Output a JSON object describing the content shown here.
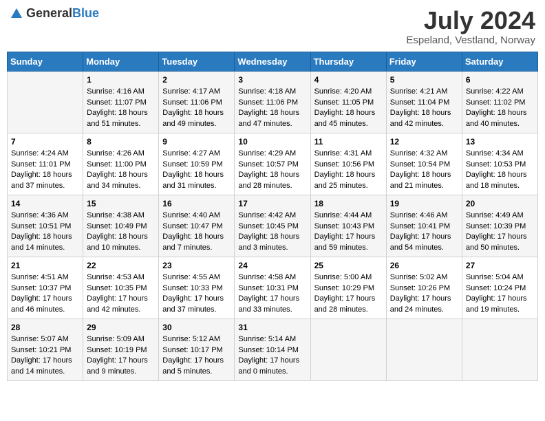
{
  "logo": {
    "text_general": "General",
    "text_blue": "Blue"
  },
  "title": {
    "main": "July 2024",
    "sub": "Espeland, Vestland, Norway"
  },
  "weekdays": [
    "Sunday",
    "Monday",
    "Tuesday",
    "Wednesday",
    "Thursday",
    "Friday",
    "Saturday"
  ],
  "weeks": [
    [
      {
        "day": "",
        "lines": []
      },
      {
        "day": "1",
        "lines": [
          "Sunrise: 4:16 AM",
          "Sunset: 11:07 PM",
          "Daylight: 18 hours",
          "and 51 minutes."
        ]
      },
      {
        "day": "2",
        "lines": [
          "Sunrise: 4:17 AM",
          "Sunset: 11:06 PM",
          "Daylight: 18 hours",
          "and 49 minutes."
        ]
      },
      {
        "day": "3",
        "lines": [
          "Sunrise: 4:18 AM",
          "Sunset: 11:06 PM",
          "Daylight: 18 hours",
          "and 47 minutes."
        ]
      },
      {
        "day": "4",
        "lines": [
          "Sunrise: 4:20 AM",
          "Sunset: 11:05 PM",
          "Daylight: 18 hours",
          "and 45 minutes."
        ]
      },
      {
        "day": "5",
        "lines": [
          "Sunrise: 4:21 AM",
          "Sunset: 11:04 PM",
          "Daylight: 18 hours",
          "and 42 minutes."
        ]
      },
      {
        "day": "6",
        "lines": [
          "Sunrise: 4:22 AM",
          "Sunset: 11:02 PM",
          "Daylight: 18 hours",
          "and 40 minutes."
        ]
      }
    ],
    [
      {
        "day": "7",
        "lines": [
          "Sunrise: 4:24 AM",
          "Sunset: 11:01 PM",
          "Daylight: 18 hours",
          "and 37 minutes."
        ]
      },
      {
        "day": "8",
        "lines": [
          "Sunrise: 4:26 AM",
          "Sunset: 11:00 PM",
          "Daylight: 18 hours",
          "and 34 minutes."
        ]
      },
      {
        "day": "9",
        "lines": [
          "Sunrise: 4:27 AM",
          "Sunset: 10:59 PM",
          "Daylight: 18 hours",
          "and 31 minutes."
        ]
      },
      {
        "day": "10",
        "lines": [
          "Sunrise: 4:29 AM",
          "Sunset: 10:57 PM",
          "Daylight: 18 hours",
          "and 28 minutes."
        ]
      },
      {
        "day": "11",
        "lines": [
          "Sunrise: 4:31 AM",
          "Sunset: 10:56 PM",
          "Daylight: 18 hours",
          "and 25 minutes."
        ]
      },
      {
        "day": "12",
        "lines": [
          "Sunrise: 4:32 AM",
          "Sunset: 10:54 PM",
          "Daylight: 18 hours",
          "and 21 minutes."
        ]
      },
      {
        "day": "13",
        "lines": [
          "Sunrise: 4:34 AM",
          "Sunset: 10:53 PM",
          "Daylight: 18 hours",
          "and 18 minutes."
        ]
      }
    ],
    [
      {
        "day": "14",
        "lines": [
          "Sunrise: 4:36 AM",
          "Sunset: 10:51 PM",
          "Daylight: 18 hours",
          "and 14 minutes."
        ]
      },
      {
        "day": "15",
        "lines": [
          "Sunrise: 4:38 AM",
          "Sunset: 10:49 PM",
          "Daylight: 18 hours",
          "and 10 minutes."
        ]
      },
      {
        "day": "16",
        "lines": [
          "Sunrise: 4:40 AM",
          "Sunset: 10:47 PM",
          "Daylight: 18 hours",
          "and 7 minutes."
        ]
      },
      {
        "day": "17",
        "lines": [
          "Sunrise: 4:42 AM",
          "Sunset: 10:45 PM",
          "Daylight: 18 hours",
          "and 3 minutes."
        ]
      },
      {
        "day": "18",
        "lines": [
          "Sunrise: 4:44 AM",
          "Sunset: 10:43 PM",
          "Daylight: 17 hours",
          "and 59 minutes."
        ]
      },
      {
        "day": "19",
        "lines": [
          "Sunrise: 4:46 AM",
          "Sunset: 10:41 PM",
          "Daylight: 17 hours",
          "and 54 minutes."
        ]
      },
      {
        "day": "20",
        "lines": [
          "Sunrise: 4:49 AM",
          "Sunset: 10:39 PM",
          "Daylight: 17 hours",
          "and 50 minutes."
        ]
      }
    ],
    [
      {
        "day": "21",
        "lines": [
          "Sunrise: 4:51 AM",
          "Sunset: 10:37 PM",
          "Daylight: 17 hours",
          "and 46 minutes."
        ]
      },
      {
        "day": "22",
        "lines": [
          "Sunrise: 4:53 AM",
          "Sunset: 10:35 PM",
          "Daylight: 17 hours",
          "and 42 minutes."
        ]
      },
      {
        "day": "23",
        "lines": [
          "Sunrise: 4:55 AM",
          "Sunset: 10:33 PM",
          "Daylight: 17 hours",
          "and 37 minutes."
        ]
      },
      {
        "day": "24",
        "lines": [
          "Sunrise: 4:58 AM",
          "Sunset: 10:31 PM",
          "Daylight: 17 hours",
          "and 33 minutes."
        ]
      },
      {
        "day": "25",
        "lines": [
          "Sunrise: 5:00 AM",
          "Sunset: 10:29 PM",
          "Daylight: 17 hours",
          "and 28 minutes."
        ]
      },
      {
        "day": "26",
        "lines": [
          "Sunrise: 5:02 AM",
          "Sunset: 10:26 PM",
          "Daylight: 17 hours",
          "and 24 minutes."
        ]
      },
      {
        "day": "27",
        "lines": [
          "Sunrise: 5:04 AM",
          "Sunset: 10:24 PM",
          "Daylight: 17 hours",
          "and 19 minutes."
        ]
      }
    ],
    [
      {
        "day": "28",
        "lines": [
          "Sunrise: 5:07 AM",
          "Sunset: 10:21 PM",
          "Daylight: 17 hours",
          "and 14 minutes."
        ]
      },
      {
        "day": "29",
        "lines": [
          "Sunrise: 5:09 AM",
          "Sunset: 10:19 PM",
          "Daylight: 17 hours",
          "and 9 minutes."
        ]
      },
      {
        "day": "30",
        "lines": [
          "Sunrise: 5:12 AM",
          "Sunset: 10:17 PM",
          "Daylight: 17 hours",
          "and 5 minutes."
        ]
      },
      {
        "day": "31",
        "lines": [
          "Sunrise: 5:14 AM",
          "Sunset: 10:14 PM",
          "Daylight: 17 hours",
          "and 0 minutes."
        ]
      },
      {
        "day": "",
        "lines": []
      },
      {
        "day": "",
        "lines": []
      },
      {
        "day": "",
        "lines": []
      }
    ]
  ]
}
